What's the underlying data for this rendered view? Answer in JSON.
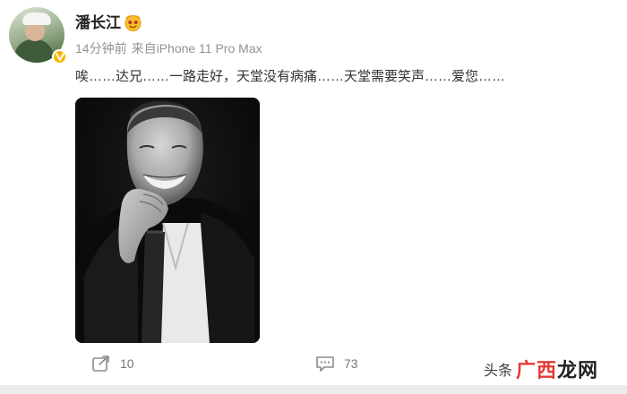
{
  "post": {
    "author": "潘长江",
    "time": "14分钟前",
    "source_prefix": "来自",
    "source_device": "iPhone 11 Pro Max",
    "text": "唉……达兄……一路走好，天堂没有病痛……天堂需要笑声……爱您……"
  },
  "actions": {
    "repost_count": "10",
    "comment_count": "73",
    "repost_icon": "share-icon",
    "comment_icon": "comment-icon"
  },
  "watermark": {
    "source": "头条",
    "brand_a": "广西",
    "brand_b": "龙网"
  },
  "colors": {
    "verified_badge": "#f7b500",
    "watermark_red": "#e53935",
    "meta_gray": "#939393"
  }
}
